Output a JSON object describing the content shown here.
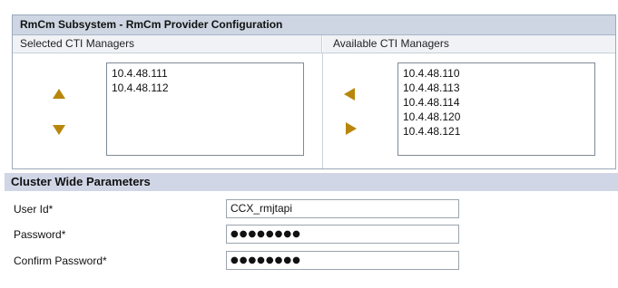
{
  "panel": {
    "title": "RmCm Subsystem - RmCm Provider Configuration",
    "selected_header": "Selected CTI Managers",
    "available_header": "Available CTI Managers",
    "selected_items": [
      "10.4.48.111",
      "10.4.48.112"
    ],
    "available_items": [
      "10.4.48.110",
      "10.4.48.113",
      "10.4.48.114",
      "10.4.48.120",
      "10.4.48.121"
    ],
    "arrow_color": "#b8860b",
    "icons": {
      "move_up": "arrow-up-icon",
      "move_down": "arrow-down-icon",
      "add": "arrow-left-icon",
      "remove": "arrow-right-icon"
    }
  },
  "cluster": {
    "title": "Cluster Wide Parameters",
    "user_id_label": "User Id*",
    "user_id_value": "CCX_rmjtapi",
    "password_label": "Password*",
    "password_value": "●●●●●●●●",
    "confirm_label": "Confirm Password*",
    "confirm_value": "●●●●●●●●"
  }
}
